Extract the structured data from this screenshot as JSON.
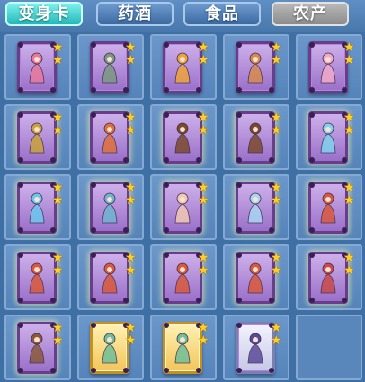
{
  "tabs": [
    {
      "label": "变身卡",
      "state": "active"
    },
    {
      "label": "药酒",
      "state": "normal"
    },
    {
      "label": "食品",
      "state": "normal"
    },
    {
      "label": "农产",
      "state": "gray"
    }
  ],
  "colors": {
    "active_tab": "#24b8b8",
    "purple_card": "#9a70c9",
    "gold_card": "#f2c55a",
    "star": "#ffcf26"
  },
  "cards": [
    {
      "icon": "pink-beast-card-icon",
      "frame": "purple",
      "stars": 2,
      "figure_color": "#e9799b"
    },
    {
      "icon": "swordswoman-card-icon",
      "frame": "purple",
      "stars": 2,
      "figure_color": "#7b9a7f"
    },
    {
      "icon": "lion-dancer-card-icon",
      "frame": "purple",
      "stars": 2,
      "figure_color": "#f0a23a"
    },
    {
      "icon": "fox-spirit-card-icon",
      "frame": "purple",
      "stars": 2,
      "figure_color": "#d78a4d"
    },
    {
      "icon": "rabbit-spirit-card-icon",
      "frame": "purple",
      "stars": 2,
      "figure_color": "#f2a9c8"
    },
    {
      "icon": "golden-warrior-card-icon",
      "frame": "purple",
      "stars": 2,
      "figure_color": "#c9a23b"
    },
    {
      "icon": "fire-bird-card-icon",
      "frame": "purple",
      "stars": 2,
      "figure_color": "#e0703a"
    },
    {
      "icon": "beast-rider-card-icon",
      "frame": "purple",
      "stars": 2,
      "figure_color": "#7b4a2d"
    },
    {
      "icon": "beast-rider-card-icon",
      "frame": "purple",
      "stars": 2,
      "figure_color": "#7b4a2d"
    },
    {
      "icon": "ice-qilin-card-icon",
      "frame": "purple",
      "stars": 2,
      "figure_color": "#7fd3f0"
    },
    {
      "icon": "ice-qilin-card-icon",
      "frame": "purple",
      "stars": 2,
      "figure_color": "#6cc7ee"
    },
    {
      "icon": "peacock-card-icon",
      "frame": "purple",
      "stars": 2,
      "figure_color": "#6fb5d0"
    },
    {
      "icon": "rabbit-girl-card-icon",
      "frame": "purple",
      "stars": 2,
      "figure_color": "#f3c7b3"
    },
    {
      "icon": "unicorn-card-icon",
      "frame": "purple",
      "stars": 2,
      "figure_color": "#a8d6f2"
    },
    {
      "icon": "monkey-warrior-card-icon",
      "frame": "purple",
      "stars": 2,
      "figure_color": "#d9593a"
    },
    {
      "icon": "monkey-warrior-card-icon",
      "frame": "purple",
      "stars": 2,
      "figure_color": "#d9593a"
    },
    {
      "icon": "monkey-warrior-card-icon",
      "frame": "purple",
      "stars": 2,
      "figure_color": "#d9593a"
    },
    {
      "icon": "monkey-warrior-card-icon",
      "frame": "purple",
      "stars": 2,
      "figure_color": "#d9593a"
    },
    {
      "icon": "monkey-warrior-card-icon",
      "frame": "purple",
      "stars": 2,
      "figure_color": "#d9593a"
    },
    {
      "icon": "dancer-card-icon",
      "frame": "purple",
      "stars": 2,
      "figure_color": "#c94a4a"
    },
    {
      "icon": "ogre-card-icon",
      "frame": "purple",
      "stars": 2,
      "figure_color": "#8a5a3a"
    },
    {
      "icon": "fairy-card-icon",
      "frame": "gold",
      "stars": 2,
      "figure_color": "#6fbf9a"
    },
    {
      "icon": "fairy-card-icon",
      "frame": "gold",
      "stars": 2,
      "figure_color": "#6fbf9a"
    },
    {
      "icon": "dark-knight-card-icon",
      "frame": "silver",
      "stars": 2,
      "figure_color": "#5b4a9a"
    },
    {
      "icon": "",
      "frame": "empty",
      "stars": 0,
      "figure_color": ""
    }
  ]
}
